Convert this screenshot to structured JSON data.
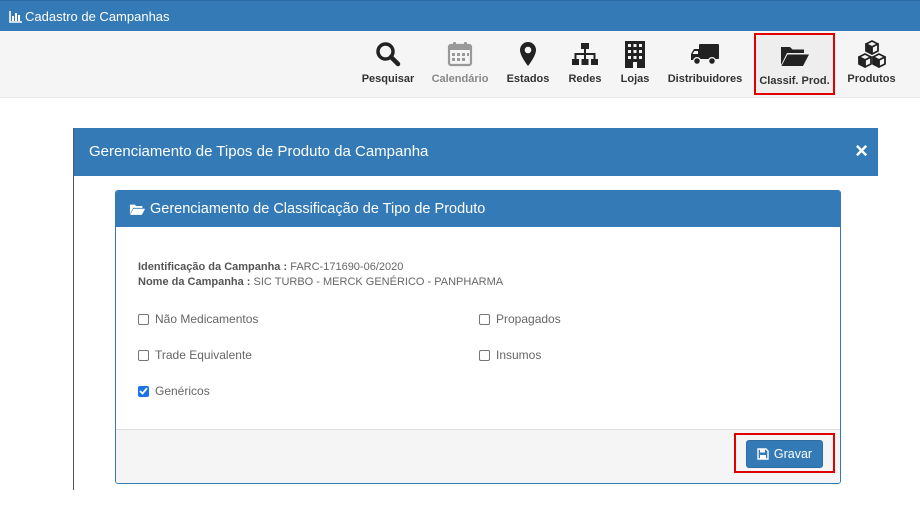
{
  "app": {
    "title": "Cadastro de Campanhas"
  },
  "toolbar": {
    "items": [
      {
        "id": "pesquisar",
        "label": "Pesquisar",
        "icon": "search-icon"
      },
      {
        "id": "calendario",
        "label": "Calendário",
        "icon": "calendar-icon",
        "disabled": true
      },
      {
        "id": "estados",
        "label": "Estados",
        "icon": "map-marker-icon"
      },
      {
        "id": "redes",
        "label": "Redes",
        "icon": "sitemap-icon"
      },
      {
        "id": "lojas",
        "label": "Lojas",
        "icon": "building-icon"
      },
      {
        "id": "distribuidores",
        "label": "Distribuidores",
        "icon": "truck-icon"
      },
      {
        "id": "classif",
        "label": "Classif. Prod.",
        "icon": "folder-open-icon",
        "active": true
      },
      {
        "id": "produtos",
        "label": "Produtos",
        "icon": "cubes-icon"
      }
    ]
  },
  "modal": {
    "title": "Gerenciamento de Tipos de Produto da Campanha",
    "close": "×",
    "panel": {
      "title": "Gerenciamento de Classificação de Tipo de Produto",
      "identificacao_label": "Identificação da Campanha :",
      "identificacao_value": "FARC-171690-06/2020",
      "nome_label": "Nome da Campanha :",
      "nome_value": "SIC TURBO - MERCK GENÉRICO - PANPHARMA",
      "options": [
        {
          "label": "Não Medicamentos",
          "checked": false
        },
        {
          "label": "Propagados",
          "checked": false
        },
        {
          "label": "Trade Equivalente",
          "checked": false
        },
        {
          "label": "Insumos",
          "checked": false
        },
        {
          "label": "Genéricos",
          "checked": true
        }
      ],
      "save_label": "Gravar"
    }
  },
  "colors": {
    "primary": "#337ab7",
    "highlight": "#e00000",
    "checkbox_checked": "#1a73e8"
  }
}
